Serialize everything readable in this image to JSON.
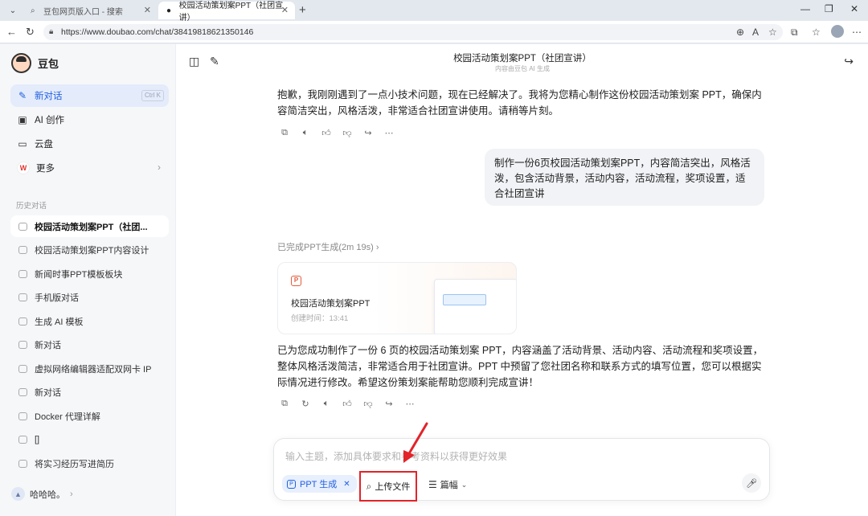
{
  "browser": {
    "tabs": [
      {
        "title": "豆包网页版入口 - 搜索"
      },
      {
        "title": "校园活动策划案PPT（社团宣讲）"
      }
    ],
    "url": "https://www.doubao.com/chat/38419818621350146"
  },
  "sidebar": {
    "brand": "豆包",
    "nav": [
      {
        "label": "新对话",
        "shortcut": "Ctrl K",
        "icon": "compose-icon"
      },
      {
        "label": "AI 创作",
        "icon": "image-icon"
      },
      {
        "label": "云盘",
        "icon": "folder-icon"
      },
      {
        "label": "更多",
        "icon": "apps-logo"
      }
    ],
    "history_label": "历史对话",
    "history": [
      "校园活动策划案PPT（社团...",
      "校园活动策划案PPT内容设计",
      "新闻时事PPT模板板块",
      "手机版对话",
      "生成 AI 模板",
      "新对话",
      "虚拟网络编辑器适配双网卡 IP",
      "新对话",
      "Docker 代理详解",
      "[]",
      "将实习经历写进简历"
    ],
    "user": "哈哈哈。"
  },
  "header": {
    "title": "校园活动策划案PPT（社团宣讲）",
    "subtitle": "内容由豆包 AI 生成"
  },
  "chat": {
    "assistant_intro": "抱歉，我刚刚遇到了一点小技术问题，现在已经解决了。我将为您精心制作这份校园活动策划案 PPT，确保内容简洁突出，风格活泼，非常适合社团宣讲使用。请稍等片刻。",
    "user_message": "制作一份6页校园活动策划案PPT，内容简洁突出，风格活泼，包含活动背景，活动内容，活动流程，奖项设置，适合社团宣讲",
    "done_status": "已完成PPT生成(2m 19s)",
    "ppt_card": {
      "name": "校园活动策划案PPT",
      "created": "创建时间：13:41"
    },
    "assistant_result": "已为您成功制作了一份 6 页的校园活动策划案 PPT，内容涵盖了活动背景、活动内容、活动流程和奖项设置，整体风格活泼简洁，非常适合用于社团宣讲。PPT 中预留了您社团名称和联系方式的填写位置，您可以根据实际情况进行修改。希望这份策划案能帮助您顺利完成宣讲！"
  },
  "composer": {
    "placeholder": "输入主题，添加具体要求和参考资料以获得更好效果",
    "chip": "PPT 生成",
    "upload": "上传文件",
    "length": "篇幅"
  },
  "colors": {
    "accent": "#1f5fe0",
    "highlight": "#e2232a"
  }
}
